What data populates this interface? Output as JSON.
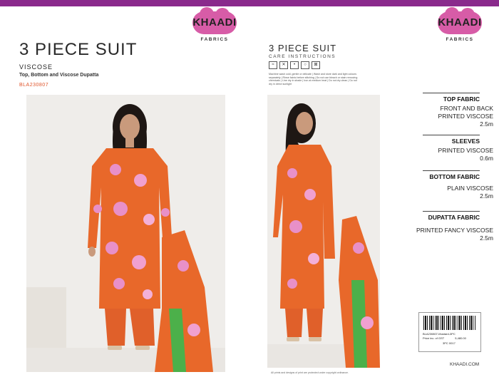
{
  "brand": {
    "name": "KHAADI",
    "sub": "FABRICS",
    "url": "KHAADI.COM"
  },
  "left": {
    "title": "3 PIECE SUIT",
    "fabric": "VISCOSE",
    "description": "Top, Bottom and Viscose  Dupatta",
    "code": "BLA230807"
  },
  "right": {
    "title": "3 PIECE SUIT",
    "care_label": "CARE INSTRUCTIONS",
    "care_icons": [
      "wash-icon",
      "no-bleach-icon",
      "iron-icon",
      "dry-clean-icon",
      "no-tumble-icon"
    ],
    "care_text": "Machine wash cold, gentle or delicate | Wash and store dark and light colours separately | Rinse fabric before stitching | Do not use bleach or stain removing chemicals | Line dry in shade | Iron at medium heat | Do not dry clean | Do not dry in direct sunlight",
    "specs": [
      {
        "head": "TOP FABRIC",
        "lines": [
          "FRONT AND BACK",
          "PRINTED VISCOSE",
          "2.5m"
        ]
      },
      {
        "head": "SLEEVES",
        "lines": [
          "PRINTED VISCOSE",
          "0.6m"
        ]
      },
      {
        "head": "BOTTOM FABRIC",
        "lines": [
          "PLAIN VISCOSE",
          "2.5m"
        ]
      },
      {
        "head": "DUPATTA FABRIC",
        "lines": [
          "PRINTED FANCY VISCOSE",
          "2.5m"
        ]
      }
    ],
    "barcode": {
      "line1": "BLA230807-Mustard-3PC",
      "price_label": "Price inc. of GST",
      "price": "5,480.00",
      "tag": "3PC 0017"
    },
    "footer_note": "All prints and designs of print are protected under copyright ordinance."
  },
  "colors": {
    "accent": "#8a2a8c",
    "logo": "#d75ca7",
    "code": "#e0542a",
    "suit": "#e8682a"
  }
}
